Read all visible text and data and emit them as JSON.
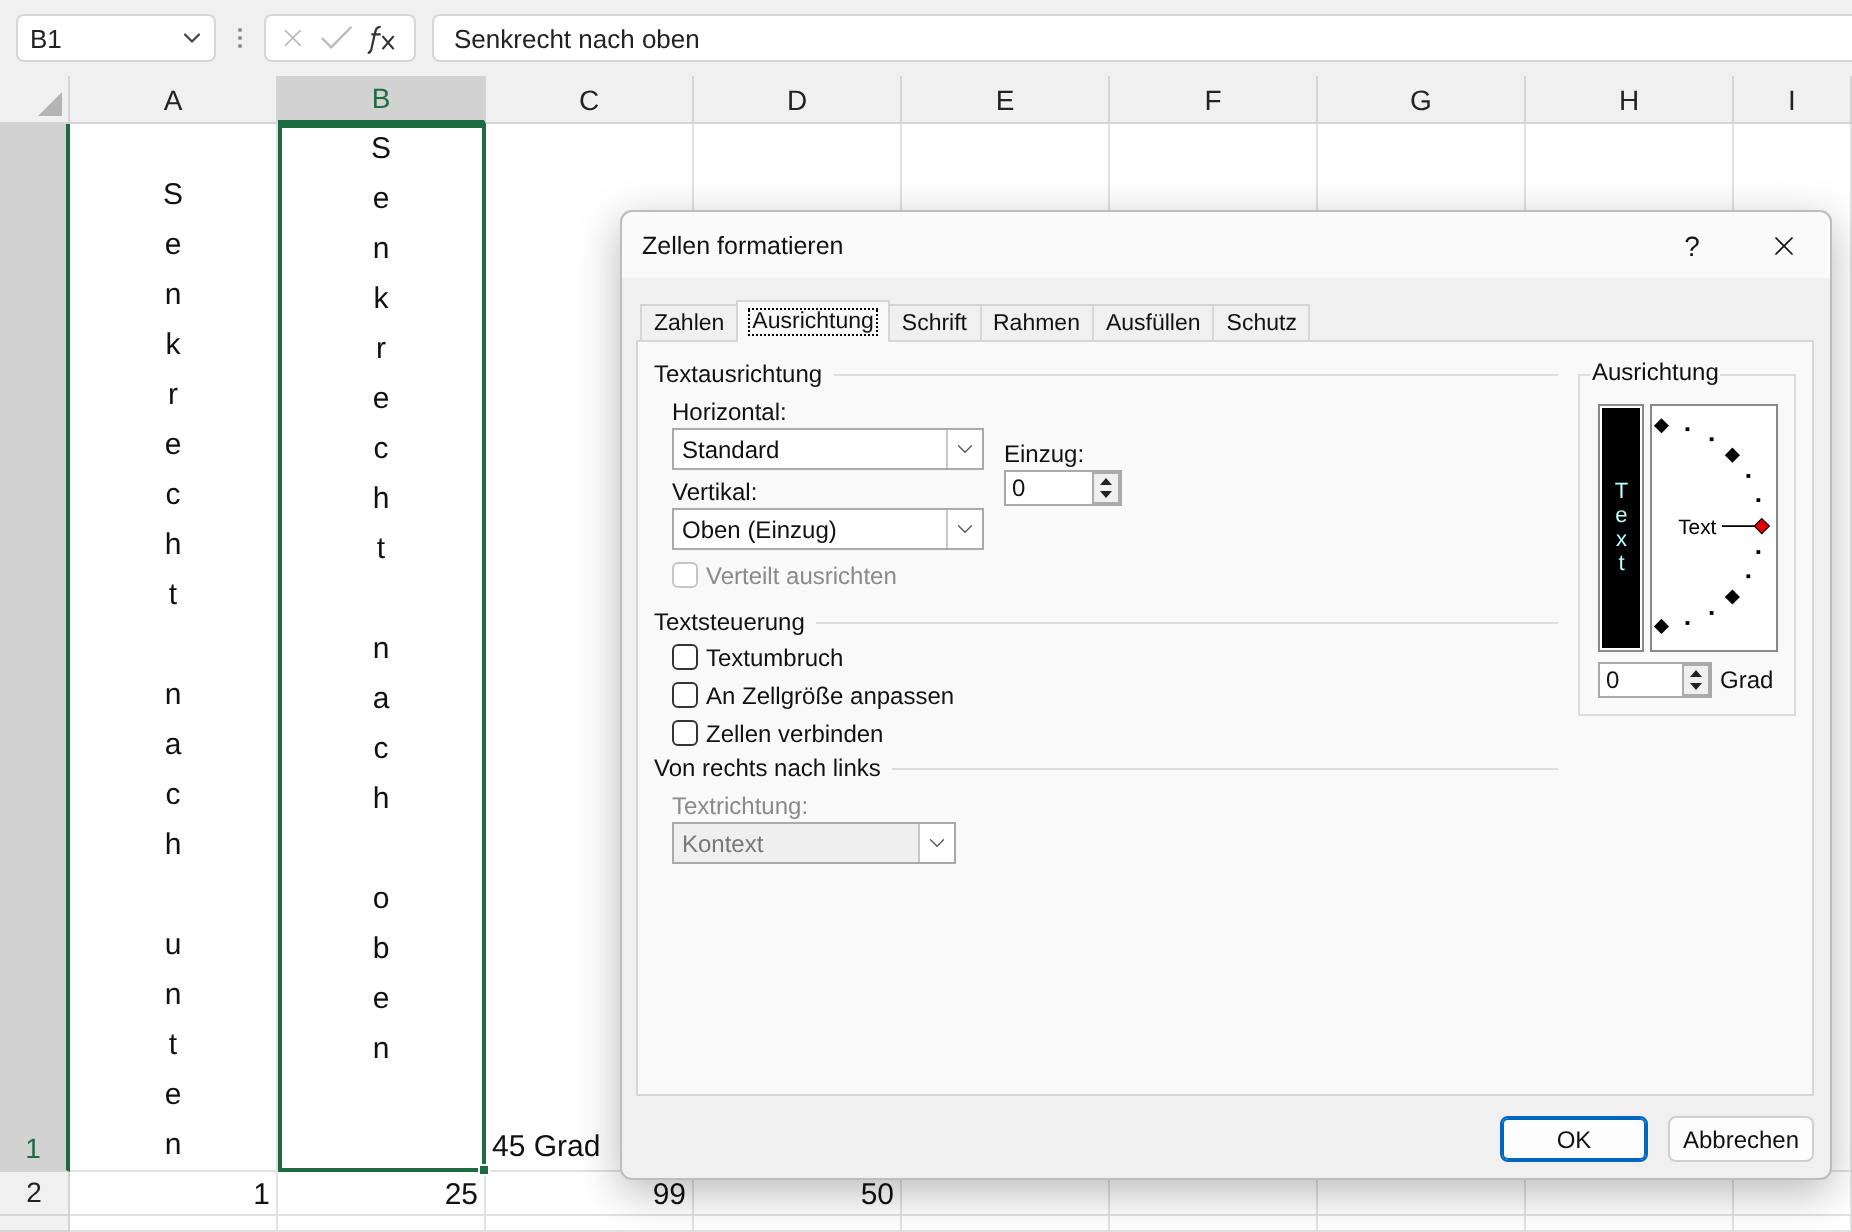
{
  "name_box": {
    "value": "B1"
  },
  "formula_bar": {
    "value": "Senkrecht nach oben"
  },
  "columns": [
    {
      "label": "A",
      "selected": false
    },
    {
      "label": "B",
      "selected": true
    },
    {
      "label": "C",
      "selected": false
    },
    {
      "label": "D",
      "selected": false
    },
    {
      "label": "E",
      "selected": false
    },
    {
      "label": "F",
      "selected": false
    },
    {
      "label": "G",
      "selected": false
    },
    {
      "label": "H",
      "selected": false
    },
    {
      "label": "I",
      "selected": false
    }
  ],
  "rows": [
    {
      "label": "1",
      "selected": true,
      "cells": [
        {
          "text": "Senkrecht nach unten",
          "kind": "vertical-bottom",
          "selected": false
        },
        {
          "text": "Senkrecht nach oben",
          "kind": "vertical-top",
          "selected": true
        },
        {
          "text": "45 Grad",
          "kind": "bottom",
          "selected": false
        }
      ]
    },
    {
      "label": "2",
      "selected": false,
      "cells": [
        {
          "text": "1",
          "kind": "number",
          "selected": false
        },
        {
          "text": "25",
          "kind": "number",
          "selected": false
        },
        {
          "text": "99",
          "kind": "number",
          "selected": false
        },
        {
          "text": "50",
          "kind": "number",
          "selected": false
        }
      ]
    }
  ],
  "dialog": {
    "title": "Zellen formatieren",
    "help": "?",
    "tabs": [
      {
        "label": "Zahlen",
        "selected": false
      },
      {
        "label": "Ausrichtung",
        "selected": true
      },
      {
        "label": "Schrift",
        "selected": false
      },
      {
        "label": "Rahmen",
        "selected": false
      },
      {
        "label": "Ausfüllen",
        "selected": false
      },
      {
        "label": "Schutz",
        "selected": false
      }
    ],
    "text_alignment": {
      "heading": "Textausrichtung",
      "horizontal": {
        "label": "Horizontal:",
        "value": "Standard"
      },
      "vertical": {
        "label": "Vertikal:",
        "value": "Oben (Einzug)"
      },
      "indent": {
        "label": "Einzug:",
        "value": "0"
      },
      "distributed": {
        "label": "Verteilt ausrichten",
        "checked": false,
        "disabled": true
      }
    },
    "text_control": {
      "heading": "Textsteuerung",
      "options": [
        {
          "label": "Textumbruch",
          "checked": false
        },
        {
          "label": "An Zellgröße anpassen",
          "checked": false
        },
        {
          "label": "Zellen verbinden",
          "checked": false
        }
      ]
    },
    "right_to_left": {
      "heading": "Von rechts nach links",
      "direction": {
        "label": "Textrichtung:",
        "value": "Kontext",
        "disabled": true
      }
    },
    "orientation": {
      "heading": "Ausrichtung",
      "vertical_text": {
        "label": "Text",
        "selected": true
      },
      "dial_label": "Text",
      "degrees": {
        "value": "0",
        "label": "Grad"
      }
    },
    "buttons": [
      {
        "label": "OK",
        "kind": "default"
      },
      {
        "label": "Abbrechen",
        "kind": "normal"
      }
    ]
  }
}
